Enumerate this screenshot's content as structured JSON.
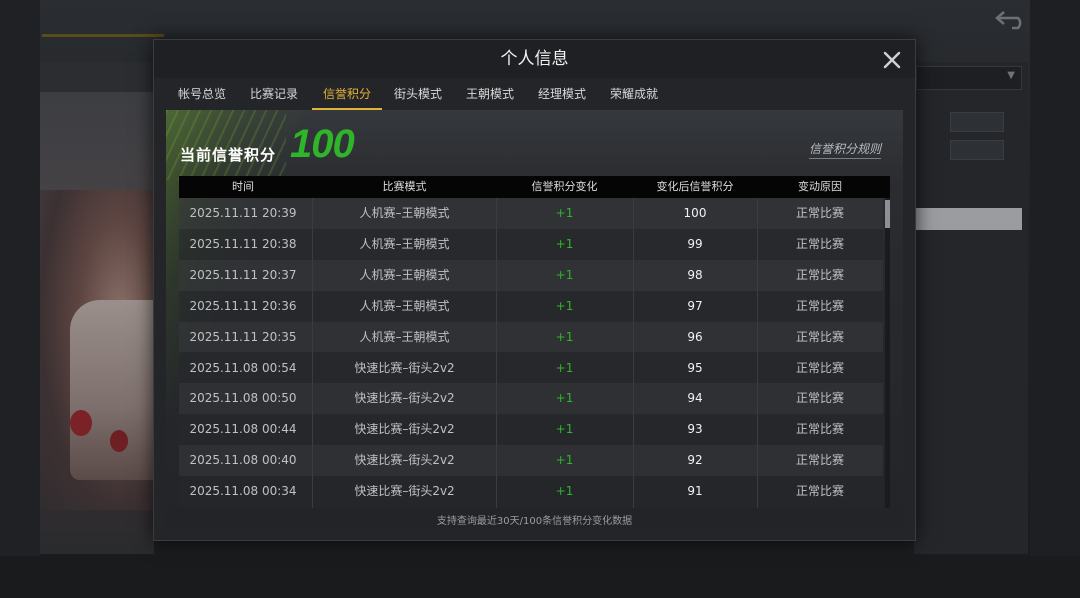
{
  "modal": {
    "title": "个人信息"
  },
  "tabs": [
    {
      "label": "帐号总览"
    },
    {
      "label": "比赛记录"
    },
    {
      "label": "信誉积分"
    },
    {
      "label": "街头模式"
    },
    {
      "label": "王朝模式"
    },
    {
      "label": "经理模式"
    },
    {
      "label": "荣耀成就"
    }
  ],
  "active_tab": "信誉积分",
  "score": {
    "label": "当前信誉积分",
    "value": "100",
    "rules_link": "信誉积分规则"
  },
  "table": {
    "headers": [
      "时间",
      "比赛模式",
      "信誉积分变化",
      "变化后信誉积分",
      "变动原因"
    ],
    "rows": [
      {
        "time": "2025.11.11  20:39",
        "mode": "人机赛–王朝模式",
        "delta": "+1",
        "new_score": "100",
        "reason": "正常比赛"
      },
      {
        "time": "2025.11.11  20:38",
        "mode": "人机赛–王朝模式",
        "delta": "+1",
        "new_score": "99",
        "reason": "正常比赛"
      },
      {
        "time": "2025.11.11  20:37",
        "mode": "人机赛–王朝模式",
        "delta": "+1",
        "new_score": "98",
        "reason": "正常比赛"
      },
      {
        "time": "2025.11.11  20:36",
        "mode": "人机赛–王朝模式",
        "delta": "+1",
        "new_score": "97",
        "reason": "正常比赛"
      },
      {
        "time": "2025.11.11  20:35",
        "mode": "人机赛–王朝模式",
        "delta": "+1",
        "new_score": "96",
        "reason": "正常比赛"
      },
      {
        "time": "2025.11.08  00:54",
        "mode": "快速比赛–街头2v2",
        "delta": "+1",
        "new_score": "95",
        "reason": "正常比赛"
      },
      {
        "time": "2025.11.08  00:50",
        "mode": "快速比赛–街头2v2",
        "delta": "+1",
        "new_score": "94",
        "reason": "正常比赛"
      },
      {
        "time": "2025.11.08  00:44",
        "mode": "快速比赛–街头2v2",
        "delta": "+1",
        "new_score": "93",
        "reason": "正常比赛"
      },
      {
        "time": "2025.11.08  00:40",
        "mode": "快速比赛–街头2v2",
        "delta": "+1",
        "new_score": "92",
        "reason": "正常比赛"
      },
      {
        "time": "2025.11.08  00:34",
        "mode": "快速比赛–街头2v2",
        "delta": "+1",
        "new_score": "91",
        "reason": "正常比赛"
      }
    ],
    "footnote": "支持查询最近30天/100条信誉积分变化数据"
  },
  "colors": {
    "accent": "#e0b33a",
    "positive": "#2fb52a",
    "header_bg": "#050505"
  },
  "icons": {
    "close": "close-icon",
    "back": "back-arrow-icon"
  }
}
